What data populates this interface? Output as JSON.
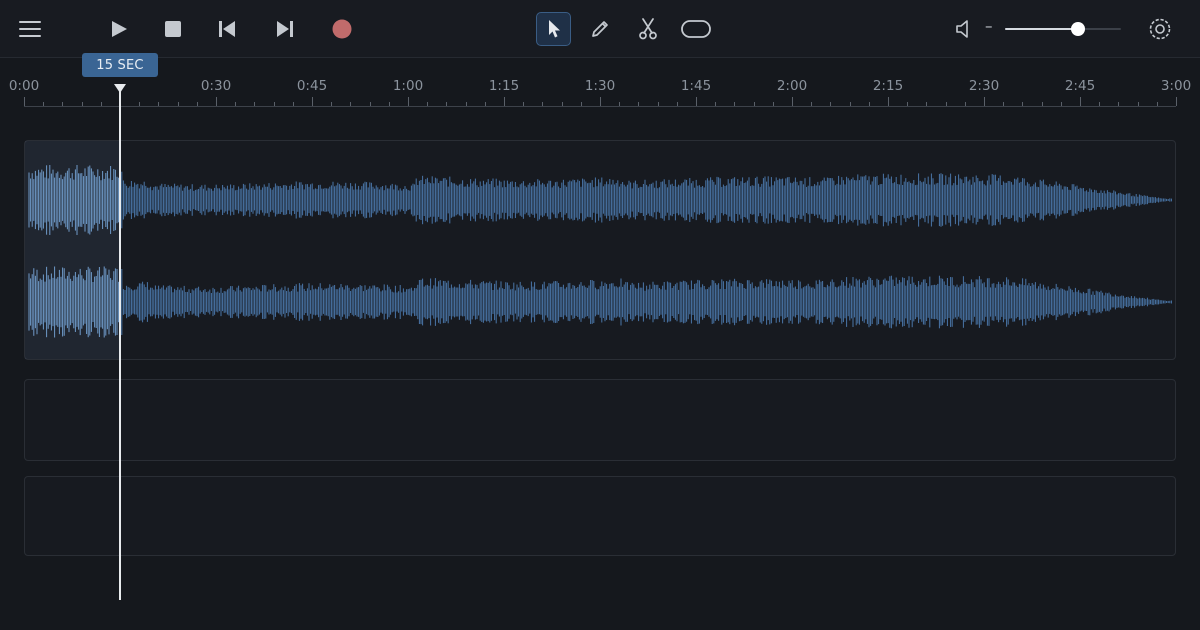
{
  "toolbar": {
    "menu_icon": "hamburger-menu-icon",
    "transport": {
      "play_icon": "play-icon",
      "stop_icon": "stop-icon",
      "skip_back_icon": "skip-to-start-icon",
      "skip_forward_icon": "skip-to-end-icon",
      "record_icon": "record-icon",
      "record_color": "#c06b6b"
    },
    "tools": [
      {
        "name": "select-tool",
        "icon": "cursor-arrow-icon",
        "active": true
      },
      {
        "name": "pencil-tool",
        "icon": "pencil-icon",
        "active": false
      },
      {
        "name": "cut-tool",
        "icon": "scissors-icon",
        "active": false
      },
      {
        "name": "loop-tool",
        "icon": "loop-icon",
        "active": false
      }
    ],
    "volume": {
      "icon": "speaker-icon",
      "decrease_symbol": "–",
      "level": 0.63
    },
    "settings_icon": "settings-icon"
  },
  "playhead": {
    "badge_label": "15 SEC",
    "time_seconds": 15
  },
  "ruler": {
    "labels": [
      "0:00",
      "0:30",
      "0:45",
      "1:00",
      "1:15",
      "1:30",
      "1:45",
      "2:00",
      "2:15",
      "2:30",
      "2:45",
      "3:00"
    ],
    "duration_seconds": 180
  },
  "tracks": [
    {
      "name": "track-1",
      "has_audio": true,
      "channels": 2,
      "selected_region_end_seconds": 15
    },
    {
      "name": "track-2",
      "has_audio": false
    },
    {
      "name": "track-3",
      "has_audio": false
    }
  ],
  "colors": {
    "accent": "#3a6594",
    "waveform": "#4a76a8",
    "waveform_highlight": "#6f9ac9",
    "background": "#15181d"
  }
}
